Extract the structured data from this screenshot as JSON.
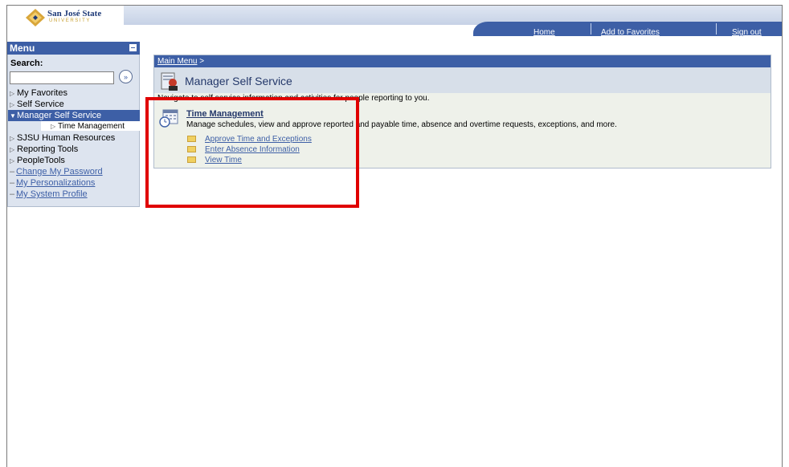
{
  "logo": {
    "name": "San José State",
    "sub": "UNIVERSITY"
  },
  "topnav": {
    "home": "Home",
    "favorites": "Add to Favorites",
    "signout": "Sign out"
  },
  "menu": {
    "title": "Menu",
    "search_label": "Search:",
    "search_value": "",
    "items": [
      {
        "label": "My Favorites"
      },
      {
        "label": "Self Service"
      },
      {
        "label": "Manager Self Service"
      },
      {
        "label": "Time Management"
      },
      {
        "label": "SJSU Human Resources"
      },
      {
        "label": "Reporting Tools"
      },
      {
        "label": "PeopleTools"
      },
      {
        "label": "Change My Password"
      },
      {
        "label": "My Personalizations"
      },
      {
        "label": "My System Profile"
      }
    ]
  },
  "content": {
    "breadcrumb": "Main Menu",
    "breadcrumb_sep": ">",
    "title": "Manager Self Service",
    "description": "Navigate to self service information and activities for people reporting to you.",
    "section_title": "Time Management",
    "section_desc": "Manage schedules, view and approve reported and payable time, absence and overtime requests, exceptions, and more.",
    "links": [
      {
        "label": "Approve Time and Exceptions"
      },
      {
        "label": "Enter Absence Information"
      },
      {
        "label": "View Time"
      }
    ]
  },
  "colors": {
    "accent": "#3d5fa6",
    "highlight_box": "#e00000",
    "menu_bg": "#dde4ef"
  }
}
